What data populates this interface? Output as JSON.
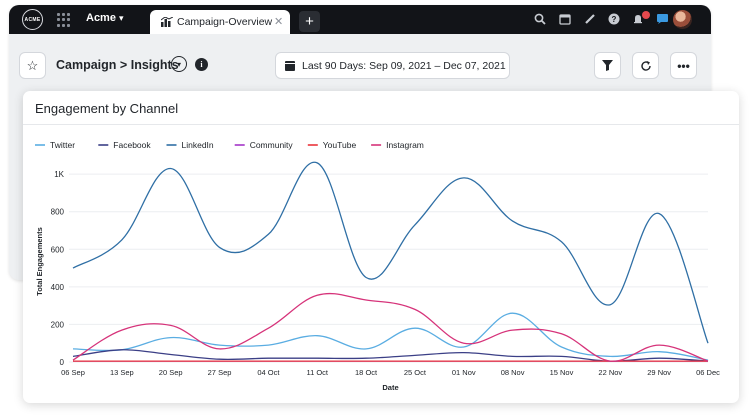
{
  "topbar": {
    "logo_text": "ACME",
    "org_name": "Acme",
    "tab_label": "Campaign-Overview"
  },
  "header": {
    "crumb_parent": "Campaign",
    "crumb_separator": ">",
    "crumb_current": "Insights",
    "date_range": "Last 90 Days: Sep 09, 2021 – Dec 07, 2021"
  },
  "icons": [
    "search-icon",
    "calendar-icon",
    "pencil-icon",
    "help-icon",
    "bell-icon",
    "chat-icon",
    "avatar",
    "star-icon",
    "filter-icon",
    "refresh-icon",
    "more-icon",
    "info-icon"
  ],
  "colors": {
    "Twitter": "#5aade2",
    "Facebook": "#3b3f86",
    "LinkedIn": "#2f6fa5",
    "Community": "#a334c8",
    "YouTube": "#e9343b",
    "Instagram": "#d6337a"
  },
  "chart_data": {
    "type": "line",
    "title": "Engagement by Channel",
    "xlabel": "Date",
    "ylabel": "Total Engagements",
    "ylim": [
      0,
      1070
    ],
    "yticks": [
      0,
      200,
      400,
      600,
      800,
      1000
    ],
    "ytick_labels": [
      "0",
      "200",
      "400",
      "600",
      "800",
      "1K"
    ],
    "categories": [
      "06 Sep",
      "13 Sep",
      "20 Sep",
      "27 Sep",
      "04 Oct",
      "11 Oct",
      "18 Oct",
      "25 Oct",
      "01 Nov",
      "08 Nov",
      "15 Nov",
      "22 Nov",
      "29 Nov",
      "06 Dec"
    ],
    "grid": true,
    "legend_position": "top-left",
    "series": [
      {
        "name": "Twitter",
        "values": [
          70,
          65,
          130,
          90,
          90,
          140,
          70,
          180,
          80,
          260,
          80,
          30,
          55,
          10
        ]
      },
      {
        "name": "Facebook",
        "values": [
          30,
          65,
          40,
          15,
          20,
          20,
          20,
          35,
          50,
          30,
          30,
          5,
          20,
          5
        ]
      },
      {
        "name": "LinkedIn",
        "values": [
          500,
          650,
          1030,
          610,
          680,
          1060,
          450,
          730,
          980,
          750,
          640,
          305,
          790,
          100
        ]
      },
      {
        "name": "Community",
        "values": [
          5,
          5,
          5,
          5,
          5,
          5,
          5,
          5,
          5,
          5,
          5,
          5,
          5,
          5
        ]
      },
      {
        "name": "YouTube",
        "values": [
          5,
          5,
          5,
          5,
          5,
          5,
          5,
          5,
          5,
          5,
          5,
          5,
          5,
          5
        ]
      },
      {
        "name": "Instagram",
        "values": [
          10,
          170,
          195,
          70,
          180,
          355,
          330,
          280,
          100,
          170,
          150,
          5,
          90,
          5
        ]
      }
    ]
  }
}
